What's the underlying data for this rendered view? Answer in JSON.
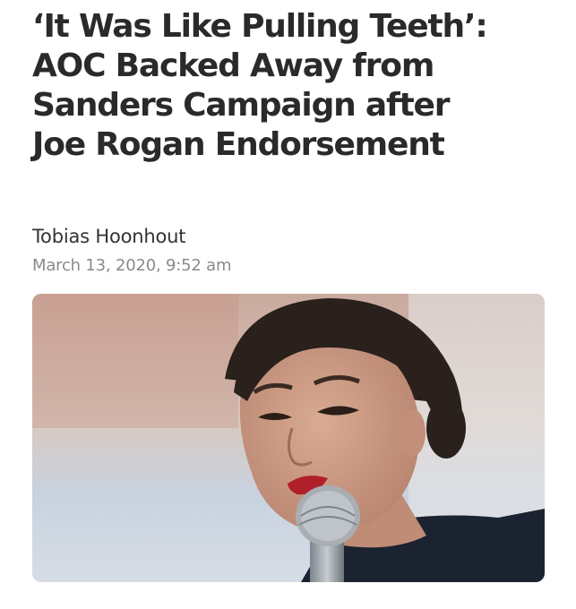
{
  "article": {
    "headline_lines": [
      "‘It Was Like Pulling Teeth’:",
      "AOC Backed Away from",
      "Sanders Campaign after",
      "Joe Rogan Endorsement"
    ],
    "author": "Tobias Hoonhout",
    "date": "March 13, 2020, 9:52 am"
  },
  "photo": {
    "subject": "woman-speaking-into-microphone",
    "colors": {
      "hair": "#2a201c",
      "skin": "#c99a83",
      "lips": "#b0202a",
      "shirt": "#1c2330",
      "mic": "#9aa0a6"
    }
  }
}
